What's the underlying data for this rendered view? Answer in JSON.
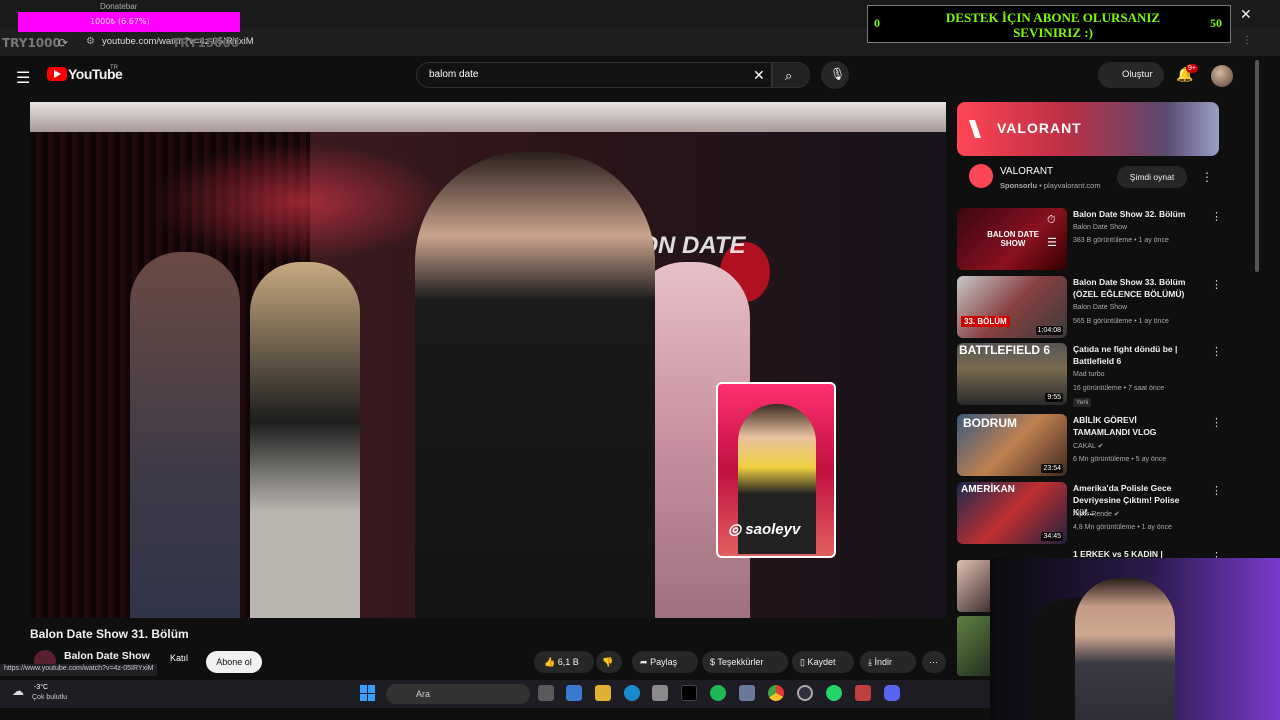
{
  "browser": {
    "donate_tab_title": "Donatebar",
    "progress_text": "1000₺ (6.67%)",
    "address": "youtube.com/watch?v=4z-05IRYxiM",
    "overlay_try_left": "TRY1000",
    "overlay_try_mid": "TRY15000"
  },
  "banner": {
    "text": "DESTEK İÇIN ABONE OLURSANIZ SEVINIRIZ :)",
    "left_value": "0",
    "right_value": "50"
  },
  "header": {
    "logo_text": "YouTube",
    "region": "TR",
    "search_value": "balom date",
    "create_label": "Oluştur",
    "notification_count": "9+"
  },
  "video": {
    "sign_text": "BALON DATE",
    "insta_handle": "saoleyv",
    "title": "Balon Date Show 31. Bölüm",
    "channel": "Balon Date Show",
    "join_label": "Katıl",
    "subscribe_label": "Abone ol",
    "like_count": "6,1 B",
    "share_label": "Paylaş",
    "thanks_label": "Teşekkürler",
    "save_label": "Kaydet",
    "download_label": "İndir",
    "hover_url": "https://www.youtube.com/watch?v=4z-05IRYxiM"
  },
  "ad": {
    "banner_word": "VALORANT",
    "name": "VALORANT",
    "sponsor": "Sponsorlu",
    "domain": "playvalorant.com",
    "cta": "Şimdi oynat"
  },
  "recommendations": [
    {
      "title": "Balon Date Show 32. Bölüm",
      "channel": "Balon Date Show",
      "meta": "383 B görüntüleme • 1 ay önce",
      "duration": "",
      "thumb_text": "BALON DATE SHOW"
    },
    {
      "title": "Balon Date Show 33. Bölüm (ÖZEL EĞLENCE BÖLÜMÜ)",
      "channel": "Balon Date Show",
      "meta": "565 B görüntüleme • 1 ay önce",
      "duration": "1:04:08",
      "thumb_text": "33. BÖLÜM"
    },
    {
      "title": "Çatıda ne fight döndü be | Battlefield 6",
      "channel": "Mad turbo",
      "meta": "16 görüntüleme • 7 saat önce",
      "duration": "9:55",
      "thumb_text": "BATTLEFIELD 6",
      "badge": "Yeni"
    },
    {
      "title": "ABİLİK GÖREVİ TAMAMLANDI VLOG",
      "channel": "CAKAL",
      "meta": "6 Mn görüntüleme • 5 ay önce",
      "duration": "23:54",
      "thumb_text": "BODRUM"
    },
    {
      "title": "Amerika'da Polisle Gece Devriyesine Çıktım! Polise Küf...",
      "channel": "Alper Rende",
      "meta": "4,8 Mn görüntüleme • 1 ay önce",
      "duration": "34:45",
      "thumb_text": "AMERİKAN"
    },
    {
      "title": "1 ERKEK vs 5 KADIN |",
      "channel": "",
      "meta": "",
      "duration": "",
      "thumb_text": ""
    }
  ],
  "taskbar": {
    "temperature": "-3°C",
    "weather": "Çok bulutlu",
    "search_label": "Ara"
  }
}
